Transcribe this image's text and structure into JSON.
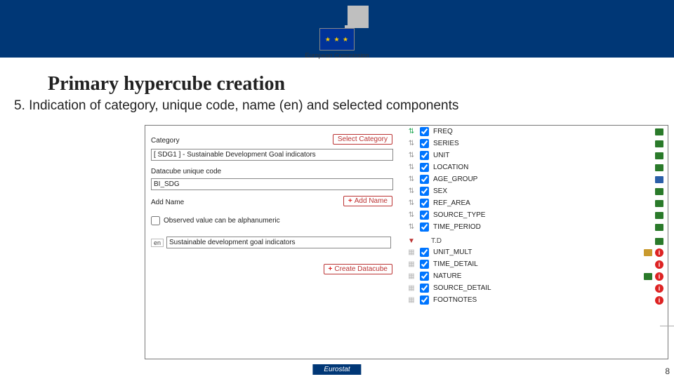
{
  "header": {
    "org": "European Commission"
  },
  "page": {
    "title": "Primary hypercube creation",
    "subtitle": "5. Indication of category, unique code, name (en) and selected components"
  },
  "form": {
    "category_label": "Category",
    "select_category_btn": "Select Category",
    "category_value": "[ SDG1 ] - Sustainable Development Goal indicators",
    "unique_code_label": "Datacube unique code",
    "unique_code_value": "BI_SDG",
    "add_name_label": "Add Name",
    "add_name_btn": "Add Name",
    "alpha_checkbox_label": "Observed value can be alphanumeric",
    "alpha_checked": false,
    "name_lang_tag": "en",
    "name_value": "Sustainable development goal indicators",
    "create_btn": "Create Datacube"
  },
  "components": {
    "section1": [
      {
        "k": "FREQ",
        "chk": true
      },
      {
        "k": "SERIES",
        "chk": true
      },
      {
        "k": "UNIT",
        "chk": true
      },
      {
        "k": "LOCATION",
        "chk": true
      },
      {
        "k": "AGE_GROUP",
        "chk": true
      },
      {
        "k": "SEX",
        "chk": true
      },
      {
        "k": "REF_AREA",
        "chk": true
      },
      {
        "k": "SOURCE_TYPE",
        "chk": true
      },
      {
        "k": "TIME_PERIOD",
        "chk": true
      }
    ],
    "section2": [
      {
        "k": "T.D"
      }
    ],
    "section3": [
      {
        "k": "UNIT_MULT",
        "chk": true
      },
      {
        "k": "TIME_DETAIL",
        "chk": true
      },
      {
        "k": "NATURE",
        "chk": true
      },
      {
        "k": "SOURCE_DETAIL",
        "chk": true
      },
      {
        "k": "FOOTNOTES",
        "chk": true
      }
    ]
  },
  "footer": {
    "caption": "Eurostat",
    "corner_number": "8"
  }
}
